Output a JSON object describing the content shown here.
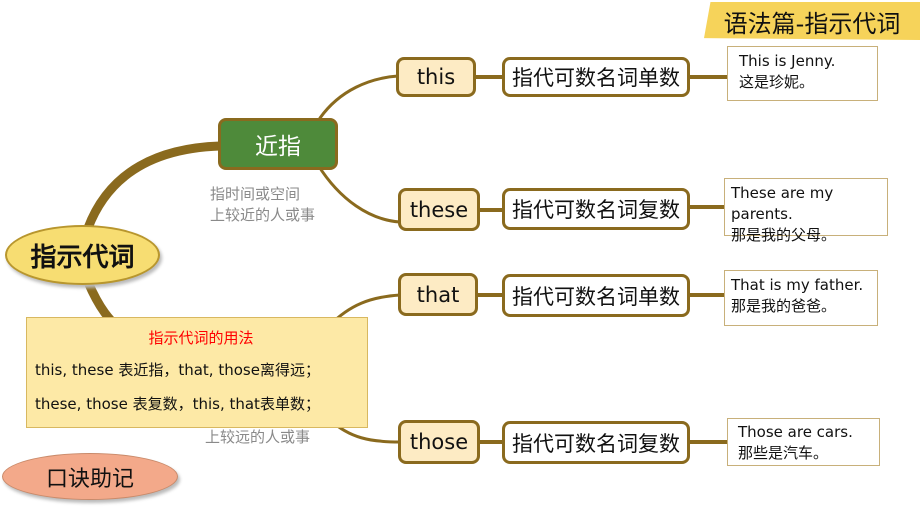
{
  "title": "语法篇-指示代词",
  "center": "指示代词",
  "near": {
    "label": "近指",
    "desc1": "指时间或空间",
    "desc2": "上较近的人或事"
  },
  "far": {
    "desc2": "上较远的人或事"
  },
  "branches": [
    {
      "word": "this",
      "meaning": "指代可数名词单数",
      "en": "This is Jenny.",
      "zh": "这是珍妮。"
    },
    {
      "word": "these",
      "meaning": "指代可数名词复数",
      "en": "These are my parents.",
      "zh": "那是我的父母。"
    },
    {
      "word": "that",
      "meaning": "指代可数名词单数",
      "en": "That is my father.",
      "zh": "那是我的爸爸。"
    },
    {
      "word": "those",
      "meaning": "指代可数名词复数",
      "en": "Those are cars.",
      "zh": "那些是汽车。"
    }
  ],
  "usage": {
    "title": "指示代词的用法",
    "line1": "this, these 表近指，that, those离得远；",
    "line2": "these, those 表复数，this, that表单数；"
  },
  "mnemonic": "口诀助记",
  "colors": {
    "connector": "#8a6a1e",
    "near": "#4e8a3a",
    "center": "#f7dd72",
    "usage_title": "#ff0000",
    "mnemonic": "#f3a98a"
  }
}
